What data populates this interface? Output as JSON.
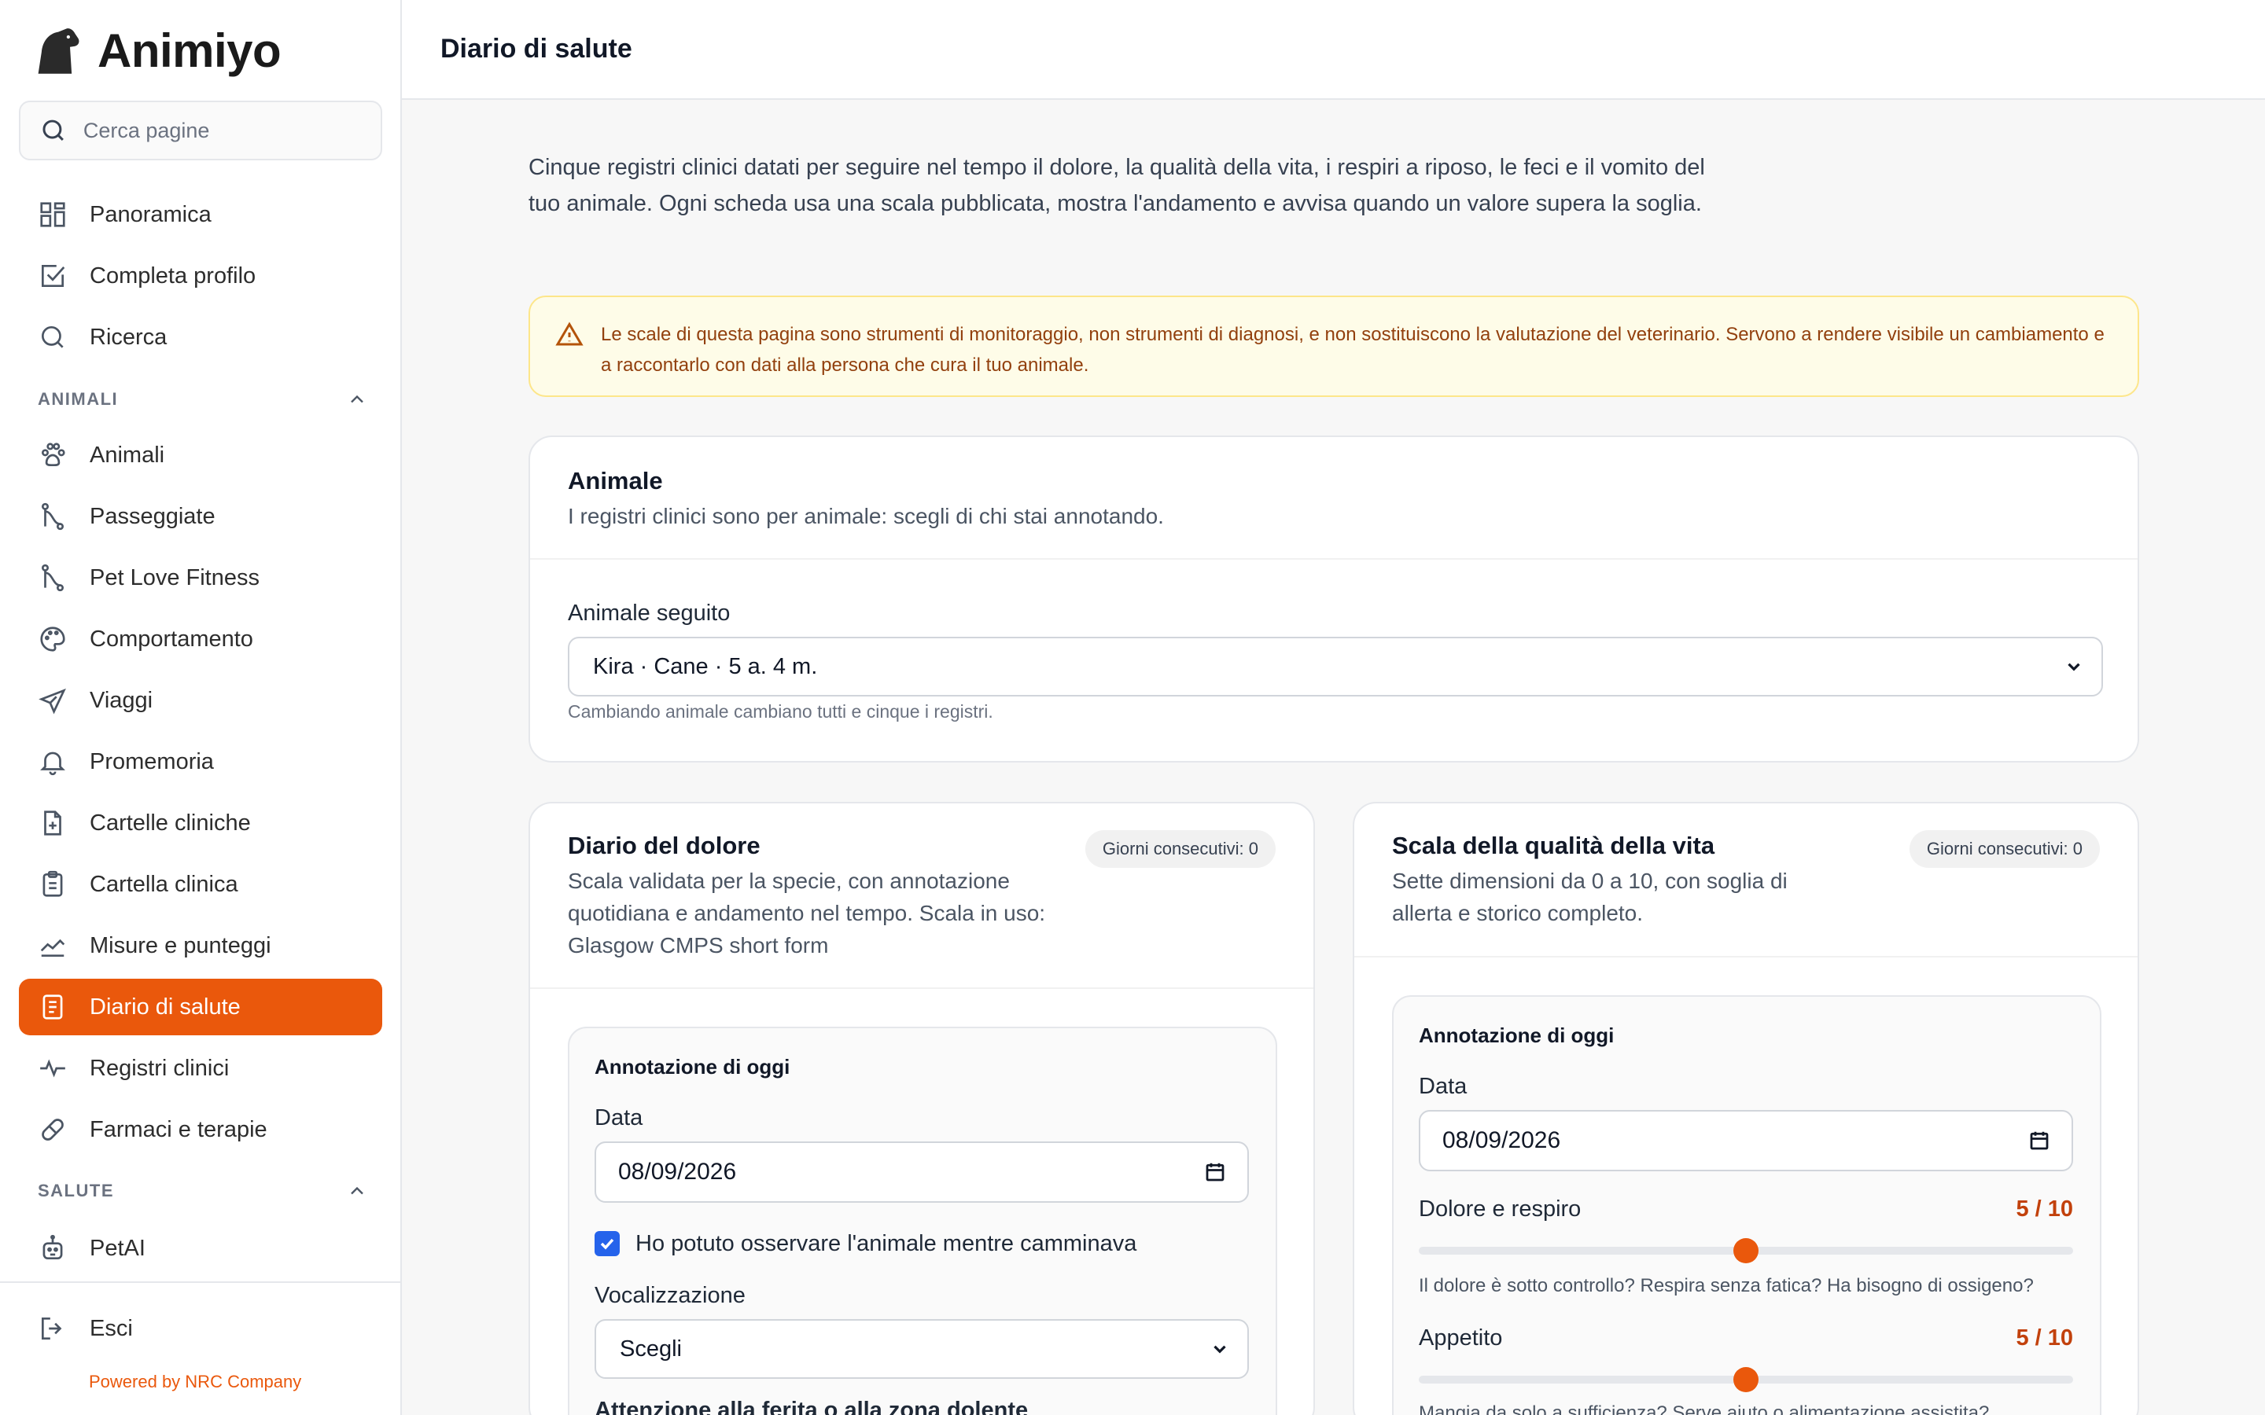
{
  "app": {
    "brand": "Animiyo",
    "search_placeholder": "Cerca pagine",
    "powered_by": "Powered by NRC Company"
  },
  "nav": {
    "top": [
      {
        "label": "Panoramica",
        "icon": "grid-icon"
      },
      {
        "label": "Completa profilo",
        "icon": "checkbox-icon"
      },
      {
        "label": "Ricerca",
        "icon": "search-icon"
      }
    ],
    "section_animali": "ANIMALI",
    "animali": [
      {
        "label": "Animali",
        "icon": "paw-icon"
      },
      {
        "label": "Passeggiate",
        "icon": "route-icon"
      },
      {
        "label": "Pet Love Fitness",
        "icon": "route-icon"
      },
      {
        "label": "Comportamento",
        "icon": "palette-icon"
      },
      {
        "label": "Viaggi",
        "icon": "plane-icon"
      },
      {
        "label": "Promemoria",
        "icon": "bell-icon"
      },
      {
        "label": "Cartelle cliniche",
        "icon": "file-plus-icon"
      },
      {
        "label": "Cartella clinica",
        "icon": "clipboard-icon"
      },
      {
        "label": "Misure e punteggi",
        "icon": "chart-line-icon"
      },
      {
        "label": "Diario di salute",
        "icon": "notebook-icon",
        "active": true
      },
      {
        "label": "Registri clinici",
        "icon": "pulse-icon"
      },
      {
        "label": "Farmaci e terapie",
        "icon": "pill-icon"
      }
    ],
    "section_salute": "SALUTE",
    "salute": [
      {
        "label": "PetAI",
        "icon": "bot-icon"
      }
    ],
    "logout": "Esci"
  },
  "header": {
    "title": "Diario di salute"
  },
  "intro": "Cinque registri clinici datati per seguire nel tempo il dolore, la qualità della vita, i respiri a riposo, le feci e il vomito del tuo animale. Ogni scheda usa una scala pubblicata, mostra l'andamento e avvisa quando un valore supera la soglia.",
  "alert": "Le scale di questa pagina sono strumenti di monitoraggio, non strumenti di diagnosi, e non sostituiscono la valutazione del veterinario. Servono a rendere visibile un cambiamento e a raccontarlo con dati alla persona che cura il tuo animale.",
  "animal_card": {
    "title": "Animale",
    "subtitle": "I registri clinici sono per animale: scegli di chi stai annotando.",
    "field_label": "Animale seguito",
    "selected": "Kira · Cane · 5 a. 4 m.",
    "hint": "Cambiando animale cambiano tutti e cinque i registri."
  },
  "pain_card": {
    "title": "Diario del dolore",
    "subtitle": "Scala validata per la specie, con annotazione quotidiana e andamento nel tempo. Scala in uso: Glasgow CMPS short form",
    "badge": "Giorni consecutivi: 0",
    "today_title": "Annotazione di oggi",
    "date_label": "Data",
    "date_value": "08/09/2026",
    "checkbox_label": "Ho potuto osservare l'animale mentre camminava",
    "checkbox_checked": true,
    "vocal_label": "Vocalizzazione",
    "vocal_value": "Scegli",
    "next_label": "Attenzione alla ferita o alla zona dolente"
  },
  "qol_card": {
    "title": "Scala della qualità della vita",
    "subtitle": "Sette dimensioni da 0 a 10, con soglia di allerta e storico completo.",
    "badge": "Giorni consecutivi: 0",
    "today_title": "Annotazione di oggi",
    "date_label": "Data",
    "date_value": "08/09/2026",
    "sliders": [
      {
        "label": "Dolore e respiro",
        "value_text": "5 / 10",
        "value": 5,
        "max": 10,
        "hint": "Il dolore è sotto controllo? Respira senza fatica? Ha bisogno di ossigeno?"
      },
      {
        "label": "Appetito",
        "value_text": "5 / 10",
        "value": 5,
        "max": 10,
        "hint": "Mangia da solo a sufficienza? Serve aiuto o alimentazione assistita?"
      }
    ]
  },
  "colors": {
    "accent": "#ea580c",
    "checkbox": "#2563eb",
    "alert_bg": "#fefce8",
    "alert_text": "#92400e"
  }
}
